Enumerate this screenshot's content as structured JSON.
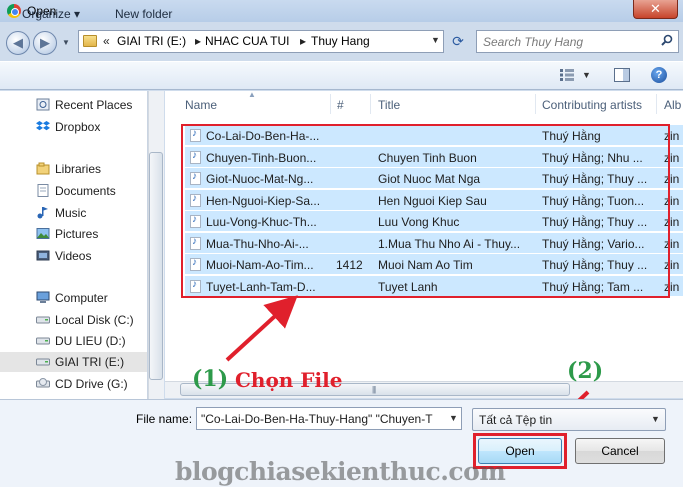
{
  "window": {
    "title": "Open",
    "close_glyph": "✕"
  },
  "address": {
    "chevrons": "«",
    "segments": [
      "GIAI TRI (E:)",
      "NHAC CUA TUI",
      "Thuy Hang"
    ],
    "separator": "▸"
  },
  "search": {
    "placeholder": "Search Thuy Hang"
  },
  "toolbar": {
    "organize_label": "Organize ▾",
    "new_folder_label": "New folder"
  },
  "nav": {
    "items": [
      {
        "label": "Recent Places",
        "icon": "recent-places-icon"
      },
      {
        "label": "Dropbox",
        "icon": "dropbox-icon"
      },
      {
        "label": "Libraries",
        "icon": "libraries-icon"
      },
      {
        "label": "Documents",
        "icon": "documents-icon"
      },
      {
        "label": "Music",
        "icon": "music-icon"
      },
      {
        "label": "Pictures",
        "icon": "pictures-icon"
      },
      {
        "label": "Videos",
        "icon": "videos-icon"
      },
      {
        "label": "Computer",
        "icon": "computer-icon"
      },
      {
        "label": "Local Disk (C:)",
        "icon": "drive-icon"
      },
      {
        "label": "DU LIEU (D:)",
        "icon": "drive-icon"
      },
      {
        "label": "GIAI TRI (E:)",
        "icon": "drive-icon",
        "selected": true
      },
      {
        "label": "CD Drive (G:)",
        "icon": "cd-drive-icon"
      }
    ]
  },
  "columns": {
    "name": "Name",
    "number": "#",
    "title": "Title",
    "artists": "Contributing artists",
    "album": "Alb"
  },
  "files": [
    {
      "name": "Co-Lai-Do-Ben-Ha-...",
      "number": "",
      "title": "",
      "artists": "Thuý Hằng",
      "album": "zin"
    },
    {
      "name": "Chuyen-Tinh-Buon...",
      "number": "",
      "title": "Chuyen Tinh Buon",
      "artists": "Thuý Hằng; Nhu ...",
      "album": "zin"
    },
    {
      "name": "Giot-Nuoc-Mat-Ng...",
      "number": "",
      "title": "Giot Nuoc Mat Nga",
      "artists": "Thuý Hằng; Thuy ...",
      "album": "zin"
    },
    {
      "name": "Hen-Nguoi-Kiep-Sa...",
      "number": "",
      "title": "Hen Nguoi Kiep Sau",
      "artists": "Thuý Hằng; Tuon...",
      "album": "zin"
    },
    {
      "name": "Luu-Vong-Khuc-Th...",
      "number": "",
      "title": "Luu Vong Khuc",
      "artists": "Thuý Hằng; Thuy ...",
      "album": "zin"
    },
    {
      "name": "Mua-Thu-Nho-Ai-...",
      "number": "",
      "title": "1.Mua Thu Nho Ai - Thuy...",
      "artists": "Thuý Hằng; Vario...",
      "album": "zin"
    },
    {
      "name": "Muoi-Nam-Ao-Tim...",
      "number": "1412",
      "title": "Muoi Nam Ao Tim",
      "artists": "Thuý Hằng; Thuy ...",
      "album": "zin"
    },
    {
      "name": "Tuyet-Lanh-Tam-D...",
      "number": "",
      "title": "Tuyet Lanh",
      "artists": "Thuý Hằng; Tam ...",
      "album": "zin"
    }
  ],
  "bottom": {
    "filename_label": "File name:",
    "filename_value": "\"Co-Lai-Do-Ben-Ha-Thuy-Hang\" \"Chuyen-T",
    "filetype_value": "Tất cả Tệp tin",
    "open_label": "Open",
    "cancel_label": "Cancel"
  },
  "annotations": {
    "step1_num": "(1)",
    "step1_text": "Chọn File",
    "step2_num": "(2)"
  },
  "watermark": "blogchiasekienthuc.com",
  "colors": {
    "highlight_red": "#e0202c",
    "annotation_green": "#2d9a4a",
    "selection_blue": "#cce8ff"
  }
}
